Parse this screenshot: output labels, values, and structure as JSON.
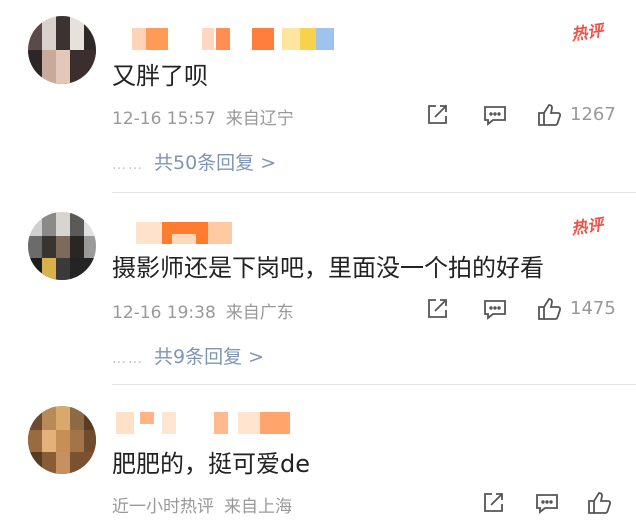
{
  "comments": [
    {
      "text": "又胖了呗",
      "time": "12-16 15:57",
      "location": "来自辽宁",
      "likes": "1267",
      "hot_label": "热评",
      "replies_label": "共50条回复",
      "replies_arrow": ">"
    },
    {
      "text": "摄影师还是下岗吧，里面没一个拍的好看",
      "time": "12-16 19:38",
      "location": "来自广东",
      "likes": "1475",
      "hot_label": "热评",
      "replies_label": "共9条回复",
      "replies_arrow": ">"
    },
    {
      "text": "肥肥的，挺可爱de",
      "time": "近一小时热评",
      "location": "来自上海"
    }
  ],
  "reply_dots": "……",
  "icons": {
    "share": "share-icon",
    "comment": "comment-icon",
    "like": "thumbs-up-icon"
  },
  "colors": {
    "hot": "#e8554a",
    "link": "#7f95b6",
    "meta": "#999999"
  }
}
